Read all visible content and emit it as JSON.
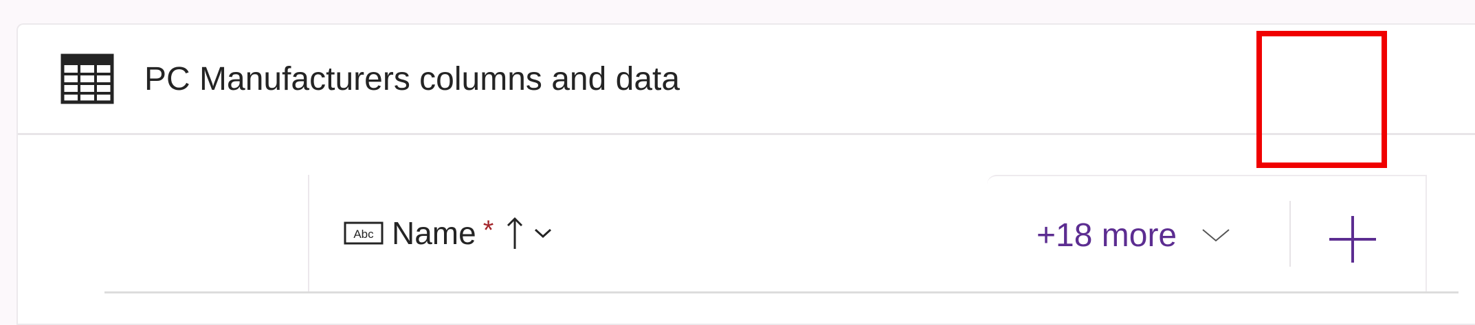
{
  "panel": {
    "title": "PC Manufacturers columns and data",
    "icon": "table-icon"
  },
  "columns": [
    {
      "name": "Name",
      "required_marker": "*",
      "type_icon": "text-abc-icon",
      "sort_icon": "sort-ascending-icon",
      "menu_icon": "chevron-down-icon"
    }
  ],
  "more_columns": {
    "label": "+18 more",
    "icon": "chevron-down-icon"
  },
  "add_column": {
    "icon": "plus-icon"
  },
  "highlight": {
    "color": "#f00000",
    "target": "add-column-button"
  },
  "colors": {
    "accent": "#5c2d91",
    "required": "#a4262c",
    "text": "#242424"
  }
}
